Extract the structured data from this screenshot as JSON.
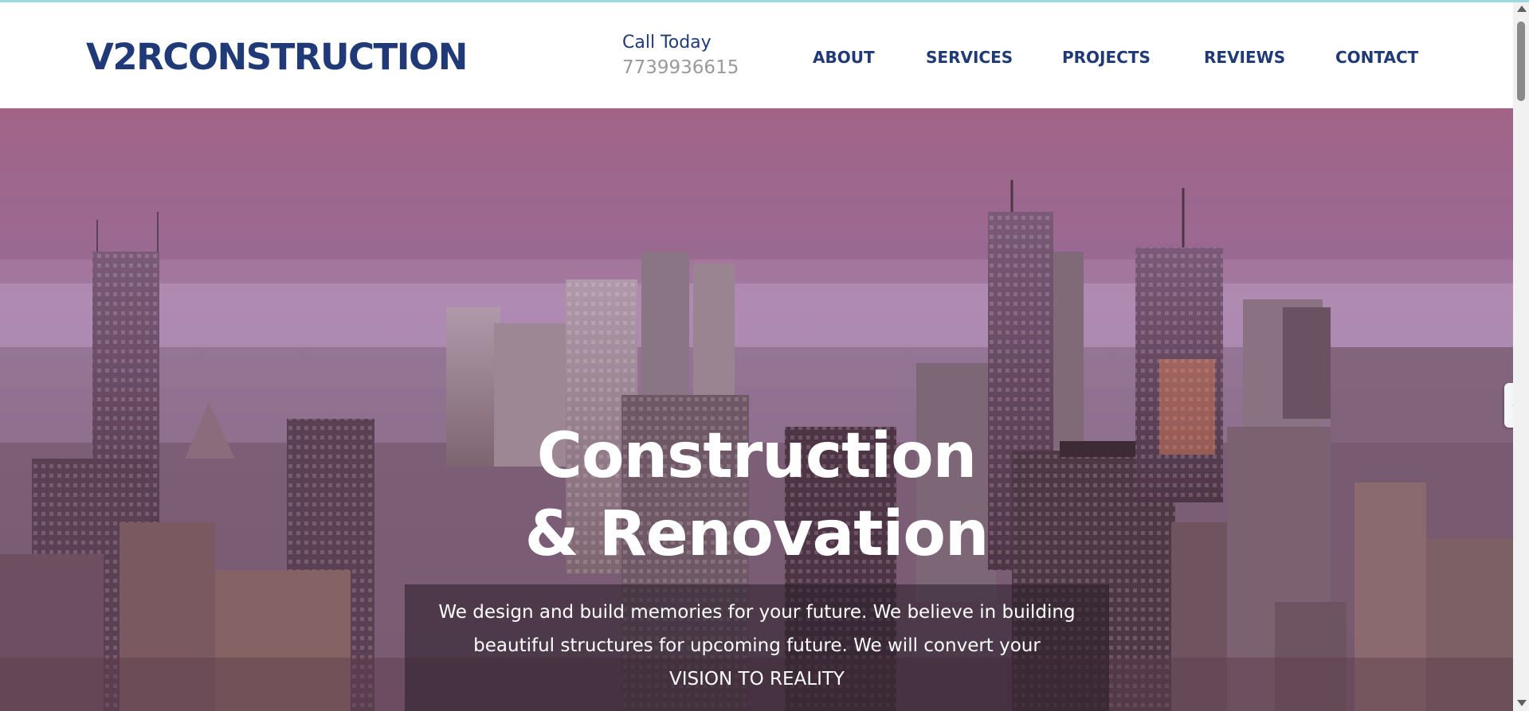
{
  "header": {
    "logo_text": "V2RCONSTRUCTION",
    "call_label": "Call Today",
    "phone": "7739936615"
  },
  "nav": {
    "items": [
      {
        "label": "ABOUT"
      },
      {
        "label": "SERVICES"
      },
      {
        "label": "PROJECTS"
      },
      {
        "label": "REVIEWS"
      },
      {
        "label": "CONTACT"
      }
    ]
  },
  "hero": {
    "title_line1": "Construction",
    "title_line2": "& Renovation",
    "tagline_line1": "We design and build memories for your future. We believe in building",
    "tagline_line2": "beautiful structures for upcoming future. We will convert your",
    "tagline_line3": "VISION TO REALITY"
  },
  "side_tab": {
    "icon": "chevron-left-icon",
    "glyph": "❮"
  },
  "colors": {
    "brand": "#1f3a76",
    "phone": "#9a9a9a",
    "hero_tint": "#8a5a8a",
    "side_tab_arrow": "#2b7fd0"
  }
}
